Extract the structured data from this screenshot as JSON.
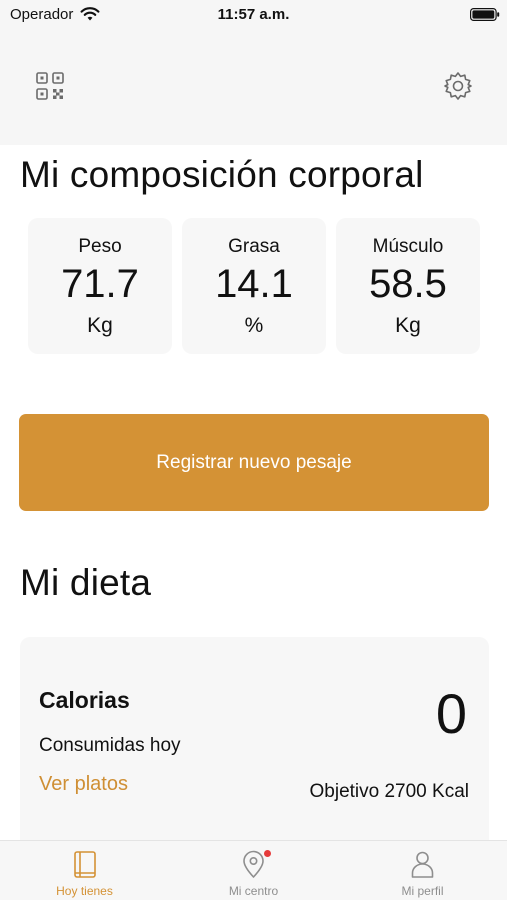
{
  "status_bar": {
    "carrier": "Operador",
    "time": "11:57 a.m."
  },
  "top_bar": {
    "left_icon": "qr-code-icon",
    "right_icon": "gear-icon"
  },
  "body_composition": {
    "title": "Mi composición corporal",
    "metrics": [
      {
        "label": "Peso",
        "value": "71.7",
        "unit": "Kg"
      },
      {
        "label": "Grasa",
        "value": "14.1",
        "unit": "%"
      },
      {
        "label": "Músculo",
        "value": "58.5",
        "unit": "Kg"
      }
    ],
    "register_label": "Registrar nuevo pesaje"
  },
  "diet": {
    "title": "Mi dieta",
    "card": {
      "title": "Calorias",
      "subtitle": "Consumidas hoy",
      "link": "Ver platos",
      "value": "0",
      "goal": "Objetivo 2700 Kcal"
    }
  },
  "tabs": [
    {
      "label": "Hoy tienes",
      "icon": "book-icon",
      "active": true
    },
    {
      "label": "Mi centro",
      "icon": "location-pin-icon",
      "active": false,
      "badge": true
    },
    {
      "label": "Mi perfil",
      "icon": "person-icon",
      "active": false
    }
  ],
  "colors": {
    "accent": "#d49235",
    "background": "#ffffff",
    "card": "#f7f7f7",
    "badge": "#e63b3b"
  }
}
